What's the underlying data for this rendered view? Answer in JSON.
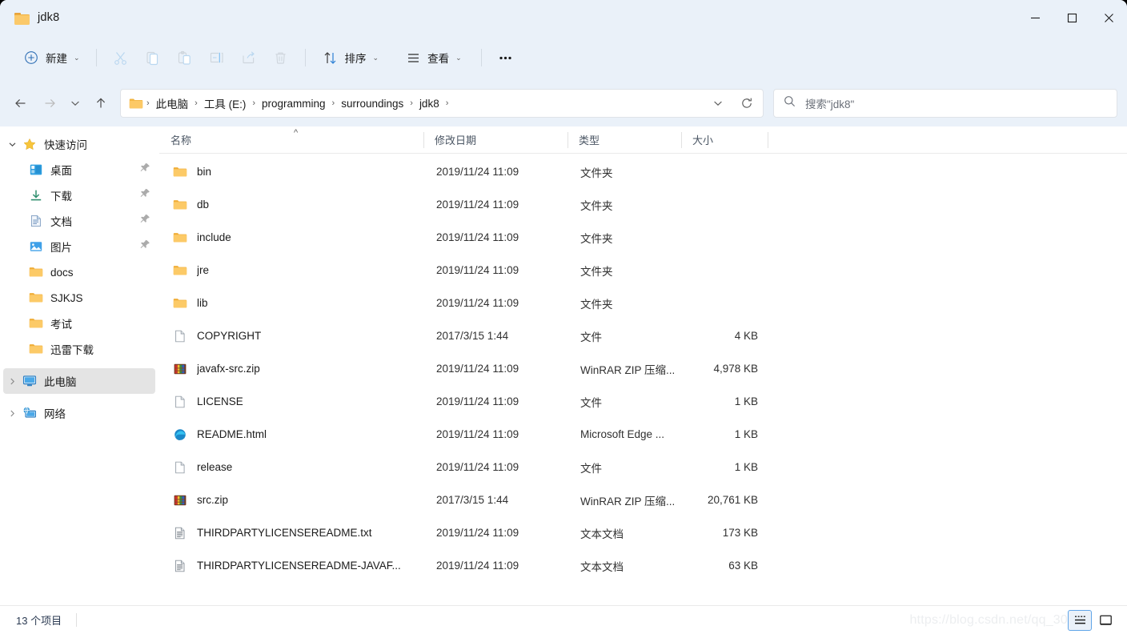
{
  "window": {
    "title": "jdk8",
    "title_icon": "folder-icon",
    "controls": {
      "minimize": "minimize-icon",
      "maximize": "maximize-icon",
      "close": "close-icon"
    }
  },
  "toolbar": {
    "new_label": "新建",
    "new_icon": "plus-circle-icon",
    "cut_icon": "scissors-icon",
    "copy_icon": "copy-icon",
    "paste_icon": "clipboard-icon",
    "rename_icon": "rename-icon",
    "share_icon": "share-icon",
    "delete_icon": "trash-icon",
    "sort_label": "排序",
    "sort_icon": "sort-arrows-icon",
    "view_label": "查看",
    "view_icon": "hamburger-icon",
    "more_icon": "ellipsis-icon",
    "chevron": "⌄"
  },
  "address": {
    "back_icon": "arrow-left-icon",
    "forward_icon": "arrow-right-icon",
    "recent_icon": "chevron-down-icon",
    "up_icon": "arrow-up-icon",
    "crumb_icon": "folder-icon",
    "crumbs": [
      "此电脑",
      "工具 (E:)",
      "programming",
      "surroundings",
      "jdk8"
    ],
    "separator": "›",
    "dropdown_icon": "chevron-down-icon",
    "refresh_icon": "refresh-icon"
  },
  "search": {
    "icon": "search-icon",
    "placeholder": "搜索\"jdk8\""
  },
  "sidebar": {
    "items": [
      {
        "label": "快速访问",
        "icon": "star-icon",
        "level": 1,
        "twisty": "expanded",
        "pinned": false,
        "selected": false
      },
      {
        "label": "桌面",
        "icon": "desktop-icon",
        "level": 2,
        "twisty": "none",
        "pinned": true,
        "selected": false
      },
      {
        "label": "下载",
        "icon": "download-icon",
        "level": 2,
        "twisty": "none",
        "pinned": true,
        "selected": false
      },
      {
        "label": "文档",
        "icon": "document-icon",
        "level": 2,
        "twisty": "none",
        "pinned": true,
        "selected": false
      },
      {
        "label": "图片",
        "icon": "pictures-icon",
        "level": 2,
        "twisty": "none",
        "pinned": true,
        "selected": false
      },
      {
        "label": "docs",
        "icon": "folder-icon",
        "level": 2,
        "twisty": "none",
        "pinned": false,
        "selected": false
      },
      {
        "label": "SJKJS",
        "icon": "folder-icon",
        "level": 2,
        "twisty": "none",
        "pinned": false,
        "selected": false
      },
      {
        "label": "考试",
        "icon": "folder-icon",
        "level": 2,
        "twisty": "none",
        "pinned": false,
        "selected": false
      },
      {
        "label": "迅雷下载",
        "icon": "folder-icon",
        "level": 2,
        "twisty": "none",
        "pinned": false,
        "selected": false
      },
      {
        "label": "此电脑",
        "icon": "computer-icon",
        "level": 1,
        "twisty": "collapsed",
        "pinned": false,
        "selected": true
      },
      {
        "label": "网络",
        "icon": "network-icon",
        "level": 1,
        "twisty": "collapsed",
        "pinned": false,
        "selected": false
      }
    ]
  },
  "columns": {
    "name": "名称",
    "date": "修改日期",
    "type": "类型",
    "size": "大小",
    "sort_indicator": "^"
  },
  "files": [
    {
      "name": "bin",
      "date": "2019/11/24 11:09",
      "type": "文件夹",
      "size": "",
      "icon": "folder-icon"
    },
    {
      "name": "db",
      "date": "2019/11/24 11:09",
      "type": "文件夹",
      "size": "",
      "icon": "folder-icon"
    },
    {
      "name": "include",
      "date": "2019/11/24 11:09",
      "type": "文件夹",
      "size": "",
      "icon": "folder-icon"
    },
    {
      "name": "jre",
      "date": "2019/11/24 11:09",
      "type": "文件夹",
      "size": "",
      "icon": "folder-icon"
    },
    {
      "name": "lib",
      "date": "2019/11/24 11:09",
      "type": "文件夹",
      "size": "",
      "icon": "folder-icon"
    },
    {
      "name": "COPYRIGHT",
      "date": "2017/3/15 1:44",
      "type": "文件",
      "size": "4 KB",
      "icon": "blank-file-icon"
    },
    {
      "name": "javafx-src.zip",
      "date": "2019/11/24 11:09",
      "type": "WinRAR ZIP 压缩...",
      "size": "4,978 KB",
      "icon": "winrar-icon"
    },
    {
      "name": "LICENSE",
      "date": "2019/11/24 11:09",
      "type": "文件",
      "size": "1 KB",
      "icon": "blank-file-icon"
    },
    {
      "name": "README.html",
      "date": "2019/11/24 11:09",
      "type": "Microsoft Edge ...",
      "size": "1 KB",
      "icon": "edge-icon"
    },
    {
      "name": "release",
      "date": "2019/11/24 11:09",
      "type": "文件",
      "size": "1 KB",
      "icon": "blank-file-icon"
    },
    {
      "name": "src.zip",
      "date": "2017/3/15 1:44",
      "type": "WinRAR ZIP 压缩...",
      "size": "20,761 KB",
      "icon": "winrar-icon"
    },
    {
      "name": "THIRDPARTYLICENSEREADME.txt",
      "date": "2019/11/24 11:09",
      "type": "文本文档",
      "size": "173 KB",
      "icon": "text-file-icon"
    },
    {
      "name": "THIRDPARTYLICENSEREADME-JAVAF...",
      "date": "2019/11/24 11:09",
      "type": "文本文档",
      "size": "63 KB",
      "icon": "text-file-icon"
    }
  ],
  "status": {
    "item_count": "13 个项目",
    "watermark": "https://blog.csdn.net/qq_30",
    "details_view_icon": "details-view-icon",
    "large_icons_view_icon": "large-icons-view-icon"
  },
  "colors": {
    "chrome": "#eaf1f9",
    "accent": "#60a5e8",
    "folder": "#fbc96a",
    "selected_row": "#e4e4e4",
    "text": "#1b1b1b"
  }
}
